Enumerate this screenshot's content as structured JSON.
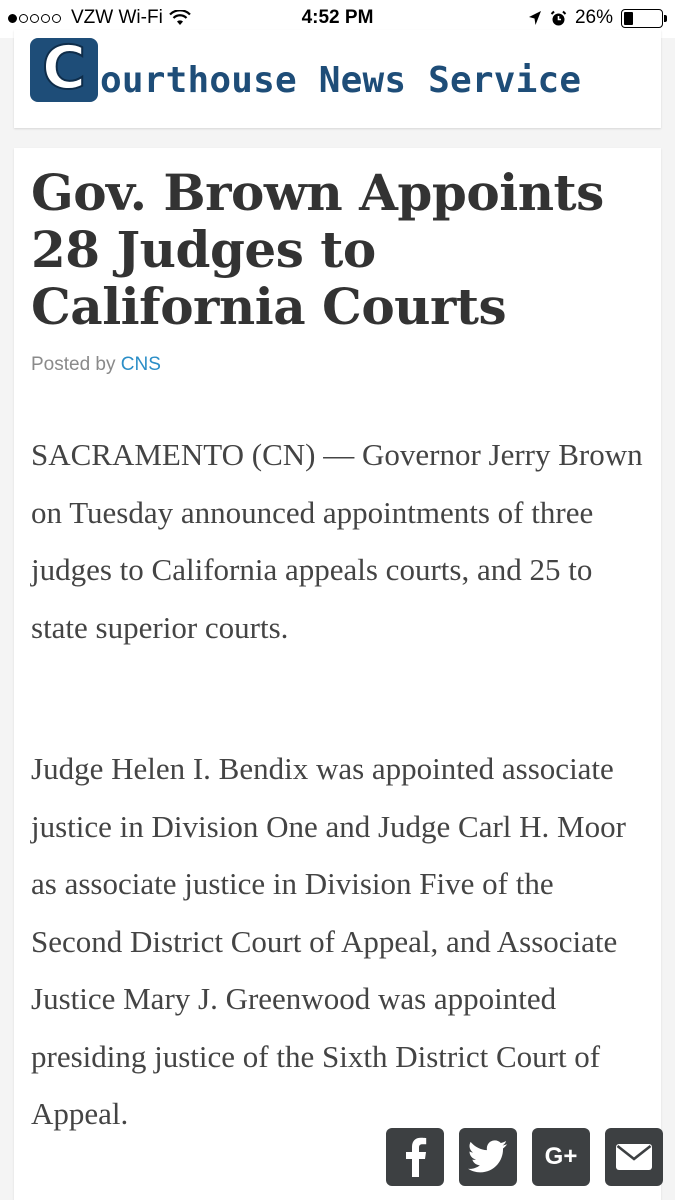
{
  "status_bar": {
    "carrier": "VZW Wi-Fi",
    "time": "4:52 PM",
    "battery": "26%",
    "battery_level": 0.26
  },
  "site": {
    "logo_letter": "C",
    "name": "ourthouse News Service"
  },
  "article": {
    "headline": "Gov. Brown Appoints 28 Judges to California Courts",
    "byline_prefix": "Posted by",
    "author": "CNS",
    "paragraphs": [
      "SACRAMENTO (CN) — Governor Jerry Brown on Tuesday announced appointments of three judges to California appeals courts, and 25 to state superior courts.",
      "Judge Helen I. Bendix was appointed associate justice in Division One and Judge Carl H. Moor as associate justice in Division Five of the Second District Court of Appeal, and Associate Justice Mary J. Greenwood was appointed presiding justice of the Sixth District Court of Appeal."
    ]
  },
  "share": {
    "facebook_icon": "facebook-icon",
    "twitter_icon": "twitter-icon",
    "googleplus_label": "G+",
    "email_icon": "email-icon"
  }
}
